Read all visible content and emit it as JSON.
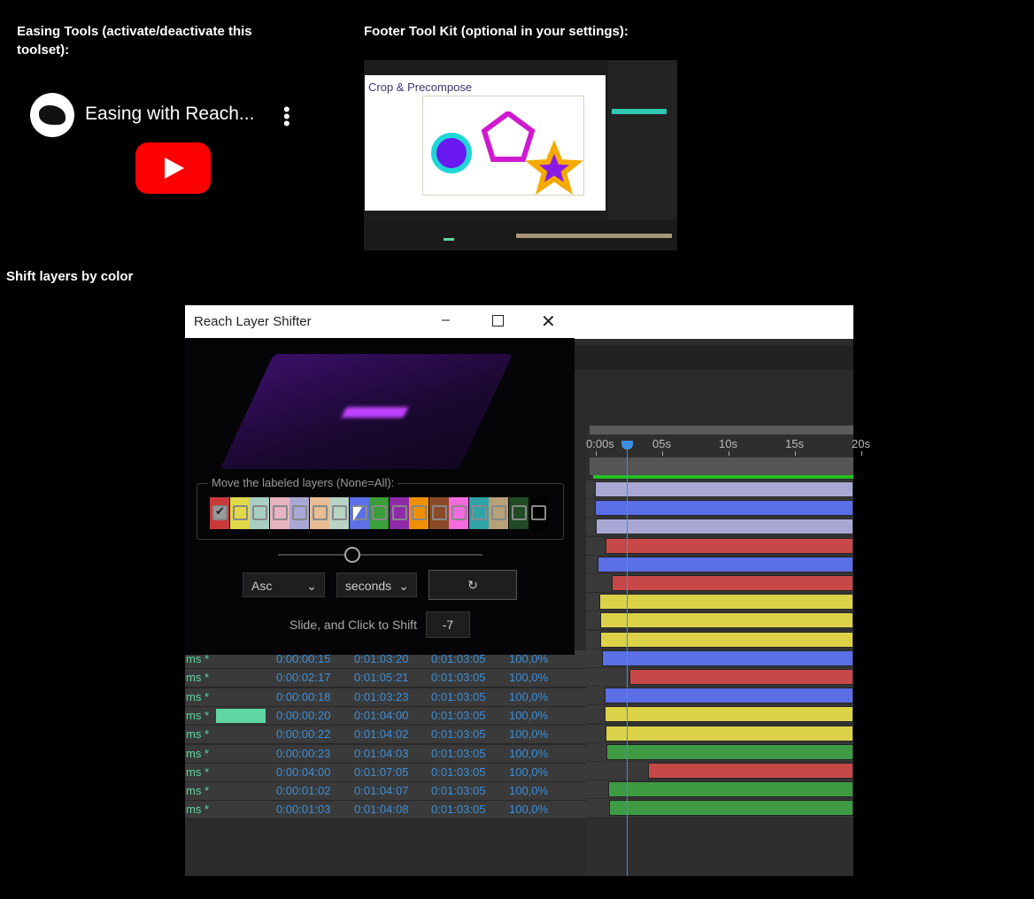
{
  "headings": {
    "easing": "Easing Tools (activate/deactivate this toolset):",
    "footer": "Footer Tool Kit (optional in your settings):",
    "shift": "Shift layers by color"
  },
  "video": {
    "title": "Easing with Reach...",
    "more_icon": "kebab-menu-icon",
    "play_icon": "youtube-play-icon",
    "brand_color": "#ff0000"
  },
  "thumbnail": {
    "comp_title": "Crop & Precompose"
  },
  "dialog": {
    "title": "Reach Layer Shifter",
    "group_label": "Move the labeled layers (None=All):",
    "swatches": [
      {
        "color": "#c83a3a",
        "checked": true
      },
      {
        "color": "#e2d94a"
      },
      {
        "color": "#a9cfc4"
      },
      {
        "color": "#e6b4c0"
      },
      {
        "color": "#a9a8d4"
      },
      {
        "color": "#e8bc95"
      },
      {
        "color": "#b9d3c5"
      },
      {
        "color": "#5b6fe6"
      },
      {
        "color": "#3a9e3a"
      },
      {
        "color": "#8e2aa8"
      },
      {
        "color": "#ef9000"
      },
      {
        "color": "#8a4a28"
      },
      {
        "color": "#f46adf"
      },
      {
        "color": "#2fa3a8"
      },
      {
        "color": "#b8a078"
      },
      {
        "color": "#1f4a24"
      },
      {
        "color": "#000000"
      }
    ],
    "order_select": "Asc",
    "unit_select": "seconds",
    "shift_button_icon": "rotate-icon",
    "shift_label": "Slide, and Click to Shift",
    "shift_value": "-7"
  },
  "timeline": {
    "ticks": [
      "0:00s",
      "05s",
      "10s",
      "15s",
      "20s"
    ],
    "playhead_seconds": 2.7,
    "rows": [
      {
        "name": "ms *",
        "in": "0:00:00:15",
        "out": "0:01:03:20",
        "dur": "0:01:03:05",
        "stretch": "100,0%"
      },
      {
        "name": "ms *",
        "in": "0:00:02:17",
        "out": "0:01:05:21",
        "dur": "0:01:03:05",
        "stretch": "100,0%"
      },
      {
        "name": "ms *",
        "in": "0:00:00:18",
        "out": "0:01:03:23",
        "dur": "0:01:03:05",
        "stretch": "100,0%"
      },
      {
        "name": "ms *",
        "in": "0:00:00:20",
        "out": "0:01:04:00",
        "dur": "0:01:03:05",
        "stretch": "100,0%",
        "label_color": "#5fd6a4"
      },
      {
        "name": "ms *",
        "in": "0:00:00:22",
        "out": "0:01:04:02",
        "dur": "0:01:03:05",
        "stretch": "100,0%"
      },
      {
        "name": "ms *",
        "in": "0:00:00:23",
        "out": "0:01:04:03",
        "dur": "0:01:03:05",
        "stretch": "100,0%"
      },
      {
        "name": "ms *",
        "in": "0:00:04:00",
        "out": "0:01:07:05",
        "dur": "0:01:03:05",
        "stretch": "100,0%"
      },
      {
        "name": "ms *",
        "in": "0:00:01:02",
        "out": "0:01:04:07",
        "dur": "0:01:03:05",
        "stretch": "100,0%"
      },
      {
        "name": "ms *",
        "in": "0:00:01:03",
        "out": "0:01:04:08",
        "dur": "0:01:03:05",
        "stretch": "100,0%"
      }
    ],
    "bars": [
      {
        "start": 0.3,
        "color": "#a9a8d4"
      },
      {
        "start": 0.35,
        "color": "#5b6fe6"
      },
      {
        "start": 0.4,
        "color": "#a9a8d4"
      },
      {
        "start": 1.1,
        "color": "#c84848"
      },
      {
        "start": 0.5,
        "color": "#5b6fe6"
      },
      {
        "start": 1.6,
        "color": "#c84848"
      },
      {
        "start": 0.65,
        "color": "#dcd24a"
      },
      {
        "start": 0.75,
        "color": "#dcd24a"
      },
      {
        "start": 0.75,
        "color": "#dcd24a"
      },
      {
        "start": 0.85,
        "color": "#5b6fe6"
      },
      {
        "start": 2.9,
        "color": "#c84848"
      },
      {
        "start": 1.05,
        "color": "#5b6fe6"
      },
      {
        "start": 1.05,
        "color": "#dcd24a"
      },
      {
        "start": 1.1,
        "color": "#dcd24a"
      },
      {
        "start": 1.2,
        "color": "#3f9a44"
      },
      {
        "start": 4.3,
        "color": "#c84848"
      },
      {
        "start": 1.35,
        "color": "#3f9a44"
      },
      {
        "start": 1.4,
        "color": "#3f9a44"
      }
    ]
  }
}
